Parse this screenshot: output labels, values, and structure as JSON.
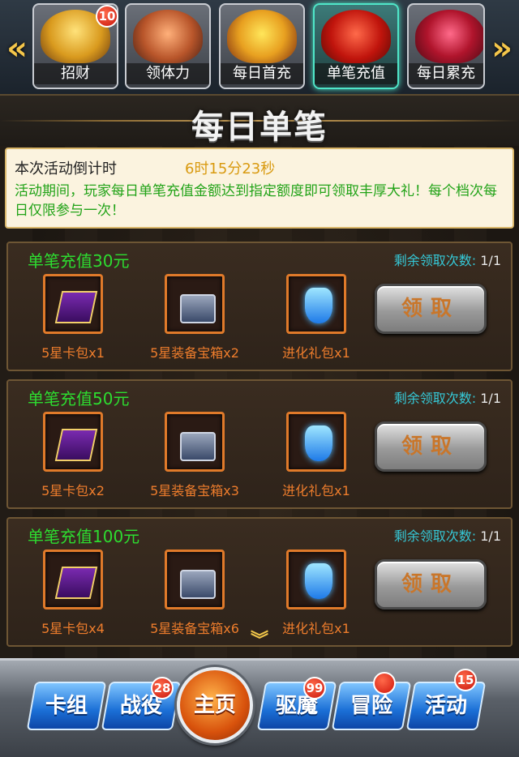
{
  "tabs": [
    {
      "label": "招财",
      "badge": "10",
      "icon": "coin-barrel-icon",
      "active": false
    },
    {
      "label": "领体力",
      "badge": null,
      "icon": "noodle-bowl-icon",
      "active": false
    },
    {
      "label": "每日首充",
      "badge": null,
      "icon": "gift-box-icon",
      "active": false
    },
    {
      "label": "单笔充值",
      "badge": null,
      "icon": "red-envelope-icon",
      "active": true
    },
    {
      "label": "每日累充",
      "badge": null,
      "icon": "treasure-chest-icon",
      "active": false
    }
  ],
  "nav_arrows": {
    "left": "«",
    "right": "»"
  },
  "page_title": "每日单笔",
  "countdown": {
    "label": "本次活动倒计时",
    "time": "6时15分23秒"
  },
  "description": "活动期间，玩家每日单笔充值金额达到指定额度即可领取丰厚大礼！每个档次每日仅限参与一次！",
  "remain_label": "剩余领取次数: ",
  "claim_label": "领取",
  "rows": [
    {
      "tier": "单笔充值30元",
      "remain": "1/1",
      "items": [
        {
          "name": "5星卡包x1",
          "icon": "card-pack-icon"
        },
        {
          "name": "5星装备宝箱x2",
          "icon": "equipment-chest-icon"
        },
        {
          "name": "进化礼包x1",
          "icon": "evolution-gem-icon"
        }
      ]
    },
    {
      "tier": "单笔充值50元",
      "remain": "1/1",
      "items": [
        {
          "name": "5星卡包x2",
          "icon": "card-pack-icon"
        },
        {
          "name": "5星装备宝箱x3",
          "icon": "equipment-chest-icon"
        },
        {
          "name": "进化礼包x1",
          "icon": "evolution-gem-icon"
        }
      ]
    },
    {
      "tier": "单笔充值100元",
      "remain": "1/1",
      "items": [
        {
          "name": "5星卡包x4",
          "icon": "card-pack-icon"
        },
        {
          "name": "5星装备宝箱x6",
          "icon": "equipment-chest-icon"
        },
        {
          "name": "进化礼包x1",
          "icon": "evolution-gem-icon"
        }
      ]
    }
  ],
  "more_indicator": "︾",
  "bottom_nav": {
    "cards": "卡组",
    "battle": "战役",
    "battle_badge": "28",
    "home": "主页",
    "demon": "驱魔",
    "demon_badge": "99",
    "adventure": "冒险",
    "activity": "活动",
    "activity_badge": "15"
  },
  "colors": {
    "tier_green": "#2ddc30",
    "desc_green": "#22a318",
    "countdown_gold": "#d99a10",
    "item_orange": "#ee7d2c",
    "remain_cyan": "#35c9d8"
  }
}
